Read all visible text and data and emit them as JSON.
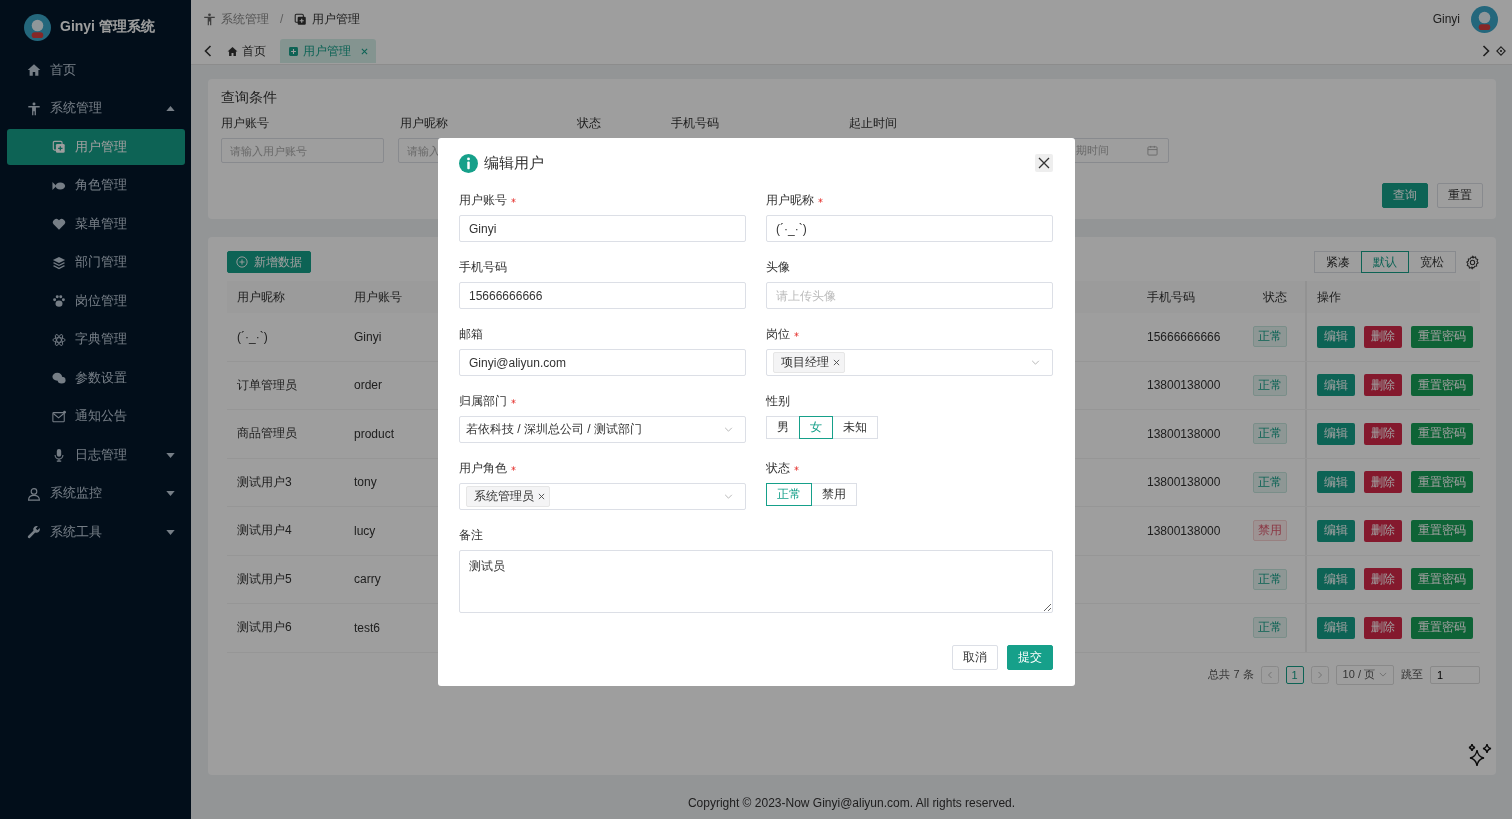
{
  "sidebar": {
    "title": "Ginyi 管理系统",
    "items": [
      {
        "label": "首页",
        "selected": false
      },
      {
        "label": "系统管理",
        "selected": false,
        "expanded": true,
        "children": [
          {
            "label": "用户管理",
            "selected": true
          },
          {
            "label": "角色管理",
            "selected": false
          },
          {
            "label": "菜单管理",
            "selected": false
          },
          {
            "label": "部门管理",
            "selected": false
          },
          {
            "label": "岗位管理",
            "selected": false
          },
          {
            "label": "字典管理",
            "selected": false
          },
          {
            "label": "参数设置",
            "selected": false
          },
          {
            "label": "通知公告",
            "selected": false
          },
          {
            "label": "日志管理",
            "selected": false,
            "expanded": false
          }
        ]
      },
      {
        "label": "系统监控",
        "selected": false,
        "expanded": false
      },
      {
        "label": "系统工具",
        "selected": false,
        "expanded": false
      }
    ]
  },
  "header": {
    "breadcrumb": [
      "系统管理",
      "用户管理"
    ],
    "separator": "/",
    "user": "Ginyi"
  },
  "tags": [
    {
      "label": "首页",
      "selected": false,
      "closable": false
    },
    {
      "label": "用户管理",
      "selected": true,
      "closable": true
    }
  ],
  "query": {
    "title": "查询条件",
    "filters": [
      {
        "label": "用户账号",
        "kind": "text",
        "placeholder": "请输入用户账号"
      },
      {
        "label": "用户昵称",
        "kind": "text",
        "placeholder": "请输入"
      },
      {
        "label": "状态",
        "kind": "label"
      },
      {
        "label": "手机号码",
        "kind": "label"
      },
      {
        "label": "起止时间",
        "kind": "date",
        "placeholder": "期时间"
      }
    ],
    "buttons": [
      {
        "label": "查询",
        "kind": "primary"
      },
      {
        "label": "重置",
        "kind": "default"
      }
    ]
  },
  "table": {
    "add_button": "新增数据",
    "density": [
      {
        "label": "紧凑",
        "selected": false
      },
      {
        "label": "默认",
        "selected": true
      },
      {
        "label": "宽松",
        "selected": false
      }
    ],
    "columns": [
      "用户昵称",
      "用户账号",
      "手机号码",
      "状态",
      "操作"
    ],
    "rows": [
      {
        "nickname": "(´·_·`)",
        "account": "Ginyi",
        "phone": "15666666666",
        "status": {
          "label": "正常",
          "kind": "normal"
        },
        "actions": [
          {
            "label": "编辑",
            "kind": "edit"
          },
          {
            "label": "删除",
            "kind": "delete"
          },
          {
            "label": "重置密码",
            "kind": "reset"
          }
        ]
      },
      {
        "nickname": "订单管理员",
        "account": "order",
        "phone": "13800138000",
        "status": {
          "label": "正常",
          "kind": "normal"
        },
        "actions": [
          {
            "label": "编辑",
            "kind": "edit"
          },
          {
            "label": "删除",
            "kind": "delete"
          },
          {
            "label": "重置密码",
            "kind": "reset"
          }
        ]
      },
      {
        "nickname": "商品管理员",
        "account": "product",
        "phone": "13800138000",
        "status": {
          "label": "正常",
          "kind": "normal"
        },
        "actions": [
          {
            "label": "编辑",
            "kind": "edit"
          },
          {
            "label": "删除",
            "kind": "delete"
          },
          {
            "label": "重置密码",
            "kind": "reset"
          }
        ]
      },
      {
        "nickname": "测试用户3",
        "account": "tony",
        "phone": "13800138000",
        "status": {
          "label": "正常",
          "kind": "normal"
        },
        "actions": [
          {
            "label": "编辑",
            "kind": "edit"
          },
          {
            "label": "删除",
            "kind": "delete"
          },
          {
            "label": "重置密码",
            "kind": "reset"
          }
        ]
      },
      {
        "nickname": "测试用户4",
        "account": "lucy",
        "phone": "13800138000",
        "status": {
          "label": "禁用",
          "kind": "disabled"
        },
        "actions": [
          {
            "label": "编辑",
            "kind": "edit"
          },
          {
            "label": "删除",
            "kind": "delete"
          },
          {
            "label": "重置密码",
            "kind": "reset"
          }
        ]
      },
      {
        "nickname": "测试用户5",
        "account": "carry",
        "status": {
          "label": "正常",
          "kind": "normal"
        },
        "actions": [
          {
            "label": "编辑",
            "kind": "edit"
          },
          {
            "label": "删除",
            "kind": "delete"
          },
          {
            "label": "重置密码",
            "kind": "reset"
          }
        ]
      },
      {
        "nickname": "测试用户6",
        "account": "test6",
        "status": {
          "label": "正常",
          "kind": "normal"
        },
        "actions": [
          {
            "label": "编辑",
            "kind": "edit"
          },
          {
            "label": "删除",
            "kind": "delete"
          },
          {
            "label": "重置密码",
            "kind": "reset"
          }
        ]
      }
    ],
    "pagination": {
      "total": "总共 7 条",
      "page": "1",
      "page_size": "10 / 页",
      "jump_label": "跳至",
      "jump_value": "1"
    }
  },
  "modal": {
    "title": "编辑用户",
    "fields": [
      {
        "kind": "input",
        "label": "用户账号",
        "required": true,
        "value": "Ginyi"
      },
      {
        "kind": "input",
        "label": "用户昵称",
        "required": true,
        "value": "(´·_·`)"
      },
      {
        "kind": "input",
        "label": "手机号码",
        "required": false,
        "value": "15666666666"
      },
      {
        "kind": "input",
        "label": "头像",
        "required": false,
        "placeholder": "请上传头像"
      },
      {
        "kind": "input",
        "label": "邮箱",
        "required": false,
        "value": "Ginyi@aliyun.com"
      },
      {
        "kind": "tags",
        "label": "岗位",
        "required": true,
        "tags": [
          "项目经理"
        ]
      },
      {
        "kind": "select",
        "label": "归属部门",
        "required": true,
        "value": "若依科技 / 深圳总公司 / 测试部门"
      },
      {
        "kind": "radio",
        "label": "性别",
        "required": false,
        "options": [
          {
            "label": "男",
            "selected": false
          },
          {
            "label": "女",
            "selected": true
          },
          {
            "label": "未知",
            "selected": false
          }
        ]
      },
      {
        "kind": "tags",
        "label": "用户角色",
        "required": true,
        "tags": [
          "系统管理员"
        ]
      },
      {
        "kind": "radio",
        "label": "状态",
        "required": true,
        "options": [
          {
            "label": "正常",
            "selected": true
          },
          {
            "label": "禁用",
            "selected": false
          }
        ]
      },
      {
        "kind": "textarea",
        "label": "备注",
        "required": false,
        "value": "测试员"
      }
    ],
    "buttons": [
      {
        "label": "取消",
        "kind": "default"
      },
      {
        "label": "提交",
        "kind": "primary"
      }
    ]
  },
  "footer": {
    "copyright": "Copyright © 2023-Now Ginyi@aliyun.com. All rights reserved."
  }
}
